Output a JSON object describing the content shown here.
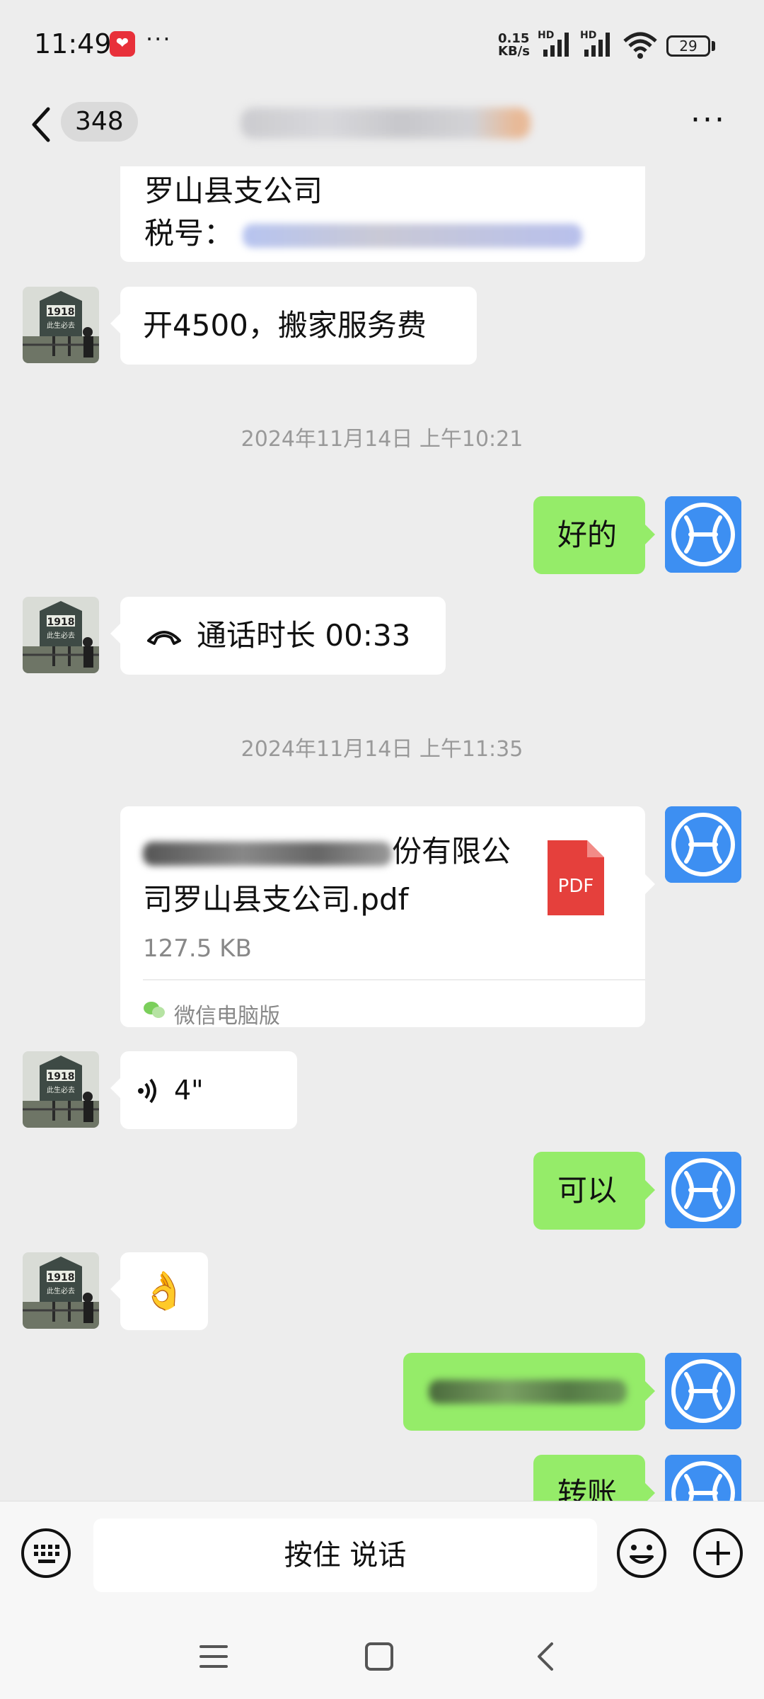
{
  "status_bar": {
    "time": "11:49",
    "more": "···",
    "net_speed_value": "0.15",
    "net_speed_unit": "KB/s",
    "sim1_label": "HD",
    "sim2_label": "HD",
    "battery": "29"
  },
  "header": {
    "unread_count": "348",
    "more": "···"
  },
  "messages": {
    "prev_card_line1": "罗山县支公司",
    "prev_card_tax_label": "税号：",
    "msg_invoice": "开4500，搬家服务费",
    "ts1": "2024年11月14日 上午10:21",
    "msg_ok": "好的",
    "msg_call": "通话时长 00:33",
    "ts2": "2024年11月14日 上午11:35",
    "file_name_visible": "份有限公",
    "file_name_line2": "司罗山县支公司.pdf",
    "file_size": "127.5 KB",
    "file_type": "PDF",
    "file_source": "微信电脑版",
    "voice_duration": "4\"",
    "msg_keyi": "可以",
    "msg_ok_emoji": "👌",
    "msg_transfer": "转账"
  },
  "input_bar": {
    "talk_label": "按住 说话"
  },
  "colors": {
    "background": "#ededed",
    "bubble_sent": "#95ec69",
    "bubble_received": "#ffffff",
    "avatar_self": "#3d8ff2",
    "pdf_red": "#e5403c"
  }
}
